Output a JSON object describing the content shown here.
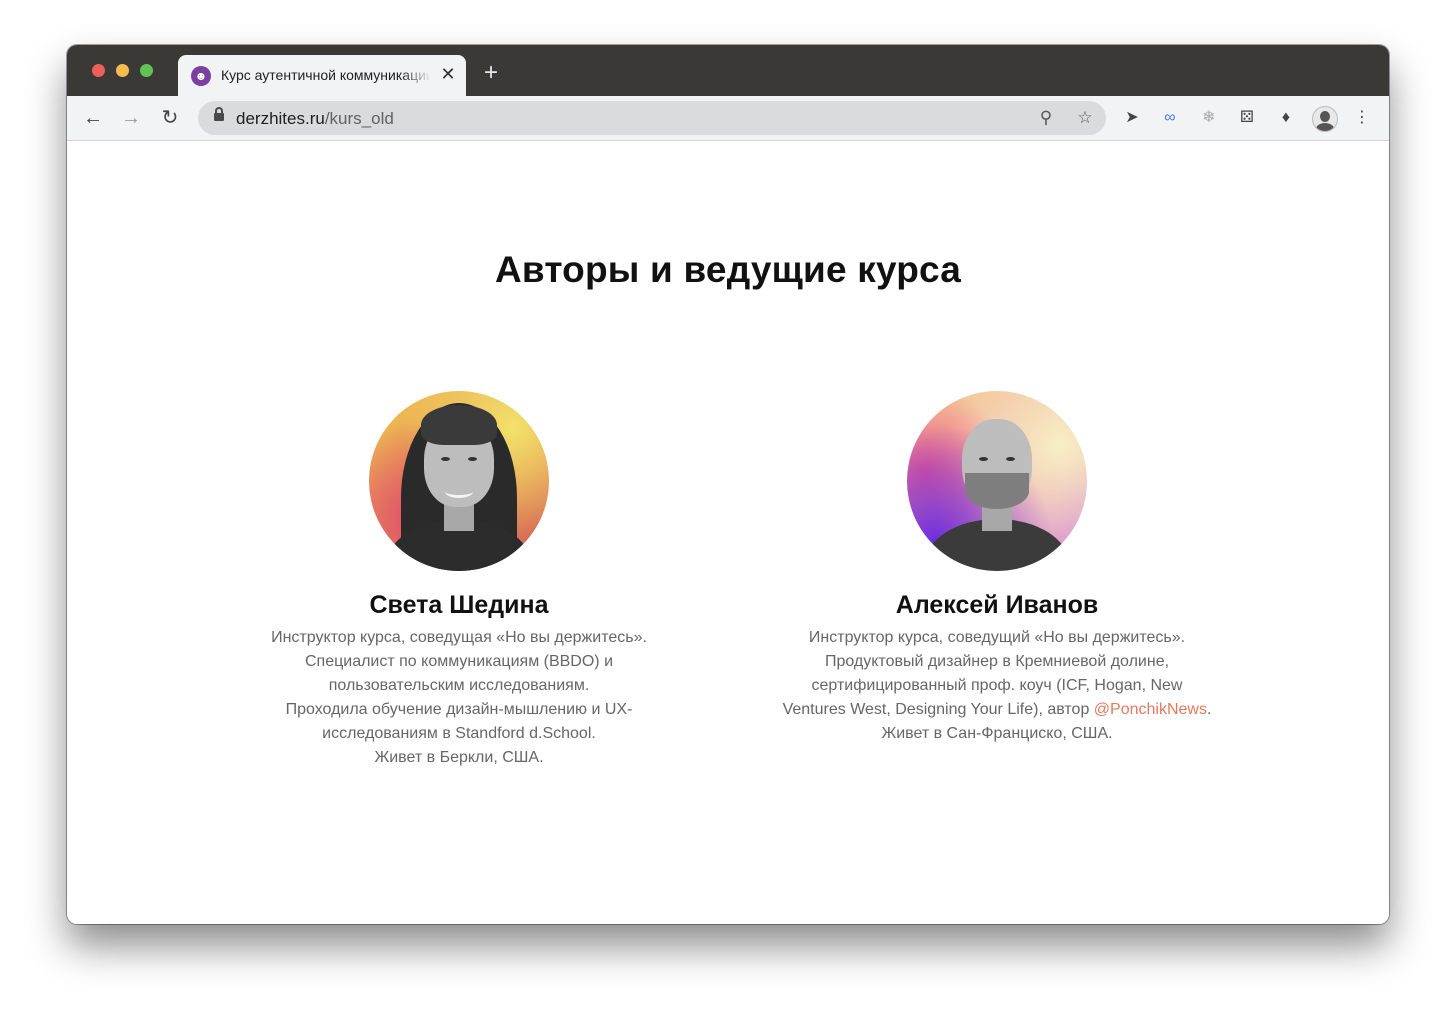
{
  "browser": {
    "tab": {
      "title": "Курс аутентичной коммуникации",
      "favicon": "smiling-devil-emoji",
      "close_label": "✕"
    },
    "new_tab_label": "+",
    "address": {
      "domain": "derzhites.ru",
      "path": "/kurs_old"
    },
    "icons": [
      "back-arrow",
      "forward-arrow",
      "reload",
      "lock",
      "zoom",
      "star",
      "rocket",
      "link",
      "palm",
      "dice",
      "puzzle",
      "avatar",
      "menu"
    ]
  },
  "page": {
    "heading": "Авторы и ведущие курса",
    "authors": [
      {
        "name": "Света Шедина",
        "bio": "Инструктор курса, соведущая «Но вы держитесь».\nСпециалист по коммуникациям (BBDO) и\nпользовательским исследованиям.\nПроходила обучение дизайн-мышлению и UX-\nисследованиям в Standford d.School.\nЖивет в Беркли, США."
      },
      {
        "name": "Алексей Иванов",
        "bio_part1": "Инструктор курса, соведущий «Но вы держитесь».\nПродуктовый дизайнер в Кремниевой долине,\nсертифицированный проф. коуч (ICF, Hogan, New\nVentures West, Designing Your Life), автор ",
        "bio_link": "@PonchikNews",
        "bio_part2": ".\nЖивет в Сан-Франциско, США."
      }
    ],
    "separator": "✦ ✦ ✦",
    "colors": {
      "link": "#e27a5e",
      "chat_button": "#6a30d4"
    }
  }
}
